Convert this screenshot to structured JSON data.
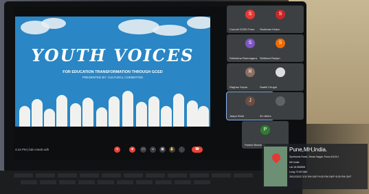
{
  "slide": {
    "title": "YOUTH VOICES",
    "subtitle": "FOR EDUCATION TRANSFORMATION THROUGH GCED",
    "presenter": "PRESENTED BY: CULTURAL COMMITTEE"
  },
  "participants": [
    {
      "name": "Council GCED Pune",
      "initial": "S",
      "color": "#e53935"
    },
    {
      "name": "Shubham Khare",
      "initial": "S",
      "color": "#c62828"
    },
    {
      "name": "Srikrishna Ramnagaraj",
      "initial": "S",
      "color": "#7e57c2"
    },
    {
      "name": "Siddhant Ranjan",
      "initial": "S",
      "color": "#ef6c00"
    },
    {
      "name": "Raghav Gupta",
      "initial": "R",
      "color": "#8d6e63"
    },
    {
      "name": "Saahil Chugul",
      "initial": "",
      "color": "#dddddd"
    },
    {
      "name": "Jaspa Shah",
      "initial": "J",
      "color": "#6d4c41"
    },
    {
      "name": "34 others",
      "initial": "",
      "color": "#5f6368"
    },
    {
      "name": "Parikul Bhardwaj",
      "initial": "P",
      "color": "#2e7d32"
    }
  ],
  "meeting": {
    "info": "4:44 PM | bdc-meeb-xdh"
  },
  "controls": {
    "mic": "mic",
    "camera": "camera",
    "captions": "CC",
    "emoji": "emoji",
    "present": "present",
    "raise_hand": "hand",
    "more": "⋮",
    "end_call": "end-call"
  },
  "geotag": {
    "title": "Pune,MH,India.",
    "address": "Symbiosis Road, Viman Nagar, Pune,411014",
    "region": "MH,India",
    "lat": "Lat 18.565898",
    "long": "Long 73.907484",
    "datetime": "29/12/2022 3:31 PM GMT+5:30 PM GMT+5:30 PM GMT"
  }
}
